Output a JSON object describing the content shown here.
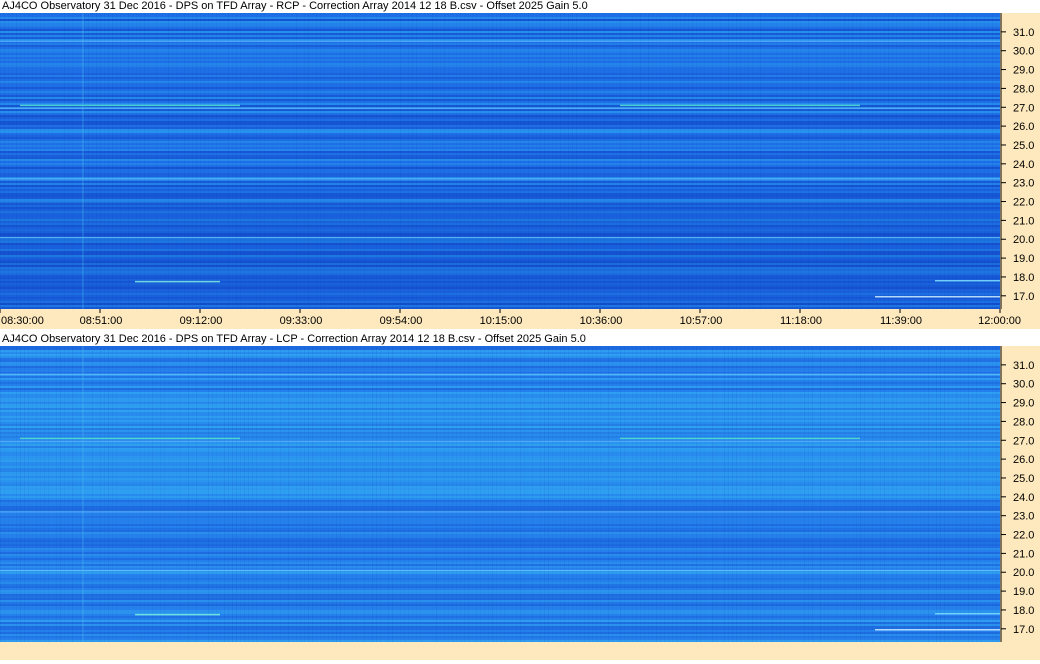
{
  "panels": [
    {
      "title": "AJ4CO Observatory 31 Dec 2016  -  DPS on TFD Array  -  RCP  -  Correction Array 2014 12 18 B.csv  -  Offset 2025  Gain 5.0",
      "base_color": "#1f6fe6",
      "dark_color": "#1248c8",
      "light_color": "#2a9ff0"
    },
    {
      "title": "AJ4CO Observatory 31 Dec 2016  -  DPS on TFD Array  -  LCP  -  Correction Array 2014 12 18 B.csv  -  Offset 2025  Gain 5.0",
      "base_color": "#2580ec",
      "dark_color": "#1a5fd8",
      "light_color": "#33aaf2"
    }
  ],
  "chart_data": [
    {
      "type": "heatmap",
      "title": "AJ4CO Observatory 31 Dec 2016  -  DPS on TFD Array  -  RCP  -  Correction Array 2014 12 18 B.csv  -  Offset 2025  Gain 5.0",
      "x_ticks": [
        "08:30:00",
        "08:51:00",
        "09:12:00",
        "09:33:00",
        "09:54:00",
        "10:15:00",
        "10:36:00",
        "10:57:00",
        "11:18:00",
        "11:39:00",
        "12:00:00"
      ],
      "y_ticks": [
        "17.0",
        "18.0",
        "19.0",
        "20.0",
        "21.0",
        "22.0",
        "23.0",
        "24.0",
        "25.0",
        "26.0",
        "27.0",
        "28.0",
        "29.0",
        "30.0",
        "31.0"
      ],
      "ylim": [
        16.3,
        32.0
      ],
      "x_range": [
        "08:30:00",
        "12:00:00"
      ]
    },
    {
      "type": "heatmap",
      "title": "AJ4CO Observatory 31 Dec 2016  -  DPS on TFD Array  -  LCP  -  Correction Array 2014 12 18 B.csv  -  Offset 2025  Gain 5.0",
      "x_ticks": [],
      "y_ticks": [
        "17.0",
        "18.0",
        "19.0",
        "20.0",
        "21.0",
        "22.0",
        "23.0",
        "24.0",
        "25.0",
        "26.0",
        "27.0",
        "28.0",
        "29.0",
        "30.0",
        "31.0"
      ],
      "ylim": [
        16.3,
        32.0
      ],
      "x_range": [
        "08:30:00",
        "12:00:00"
      ]
    }
  ]
}
